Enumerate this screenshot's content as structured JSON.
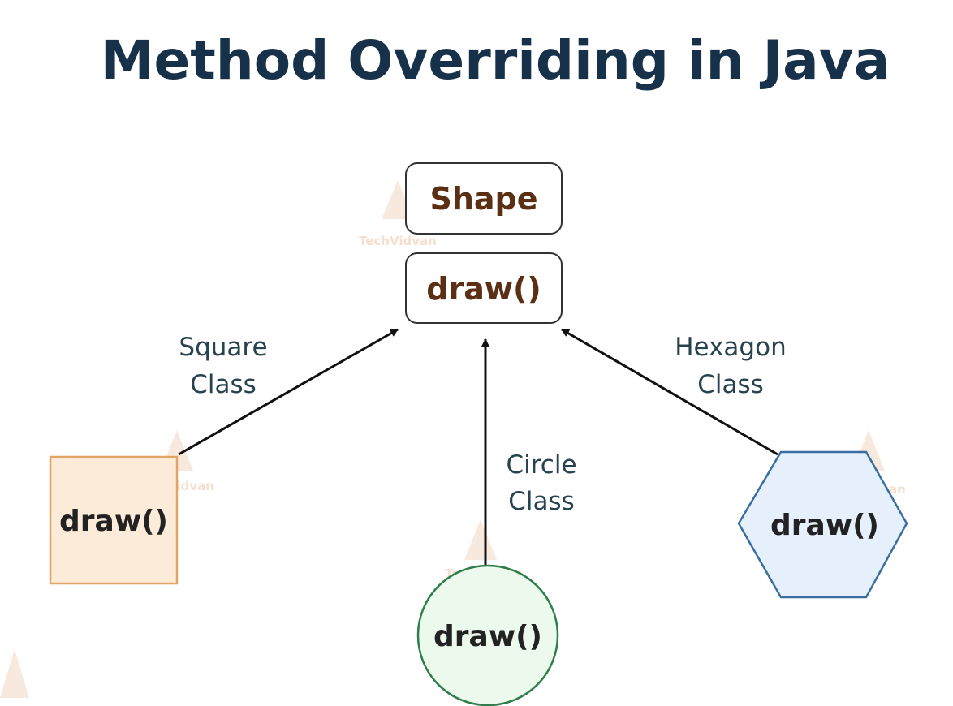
{
  "title": "Method Overriding in Java",
  "parent": {
    "class_name": "Shape",
    "method": "draw()"
  },
  "children": {
    "square": {
      "label_line1": "Square",
      "label_line2": "Class",
      "method": "draw()"
    },
    "circle": {
      "label_line1": "Circle",
      "label_line2": "Class",
      "method": "draw()"
    },
    "hexagon": {
      "label_line1": "Hexagon",
      "label_line2": "Class",
      "method": "draw()"
    }
  },
  "watermark": "TechVidvan",
  "colors": {
    "title": "#17314a",
    "parent_text": "#5b2f14",
    "square_fill": "#fcebd9",
    "square_stroke": "#e3a566",
    "circle_fill": "#ecfaee",
    "circle_stroke": "#2f7d4a",
    "hexagon_fill": "#e5f0fc",
    "hexagon_stroke": "#3a6ea0",
    "arrow": "#111111"
  }
}
